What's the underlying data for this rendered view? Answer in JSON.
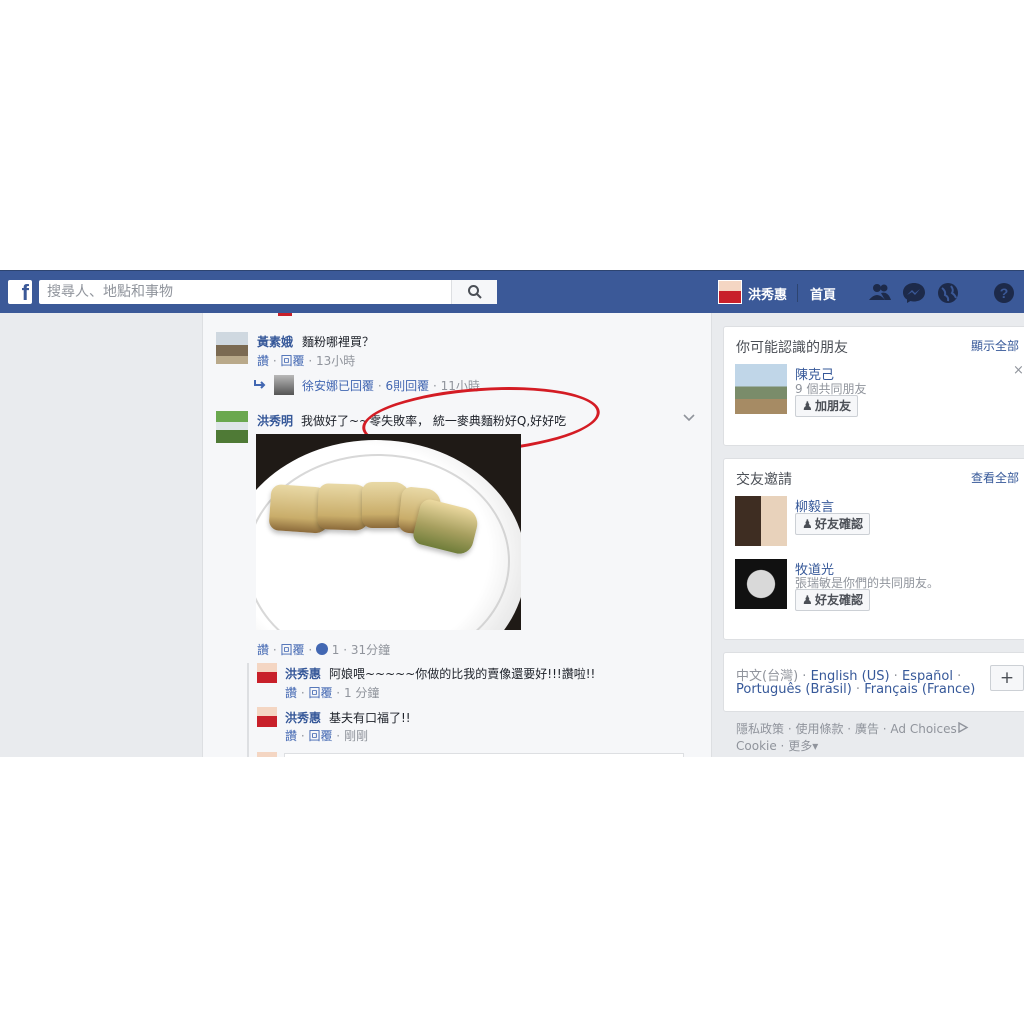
{
  "search": {
    "placeholder": "搜尋人、地點和事物"
  },
  "topbar": {
    "user_name": "洪秀惠",
    "home_label": "首頁"
  },
  "comments": [
    {
      "author": "黃素娥",
      "text": "麵粉哪裡買？",
      "like": "讚",
      "reply": "回覆",
      "time": "13小時",
      "replies_summary": {
        "author": "徐安娜",
        "action": "已回覆",
        "count": "6則回覆",
        "time": "11小時"
      }
    },
    {
      "author": "洪秀明",
      "text": "我做好了~~零失敗率， 統一麥典麵粉好Q,好好吃",
      "like": "讚",
      "reply": "回覆",
      "reaction_count": "1",
      "time": "31分鐘",
      "replies": [
        {
          "author": "洪秀惠",
          "text": "阿娘喂~~~~~你做的比我的賣像還要好!!!讚啦!!",
          "like": "讚",
          "reply": "回覆",
          "time": "1 分鐘"
        },
        {
          "author": "洪秀惠",
          "text": "基夫有口福了!!",
          "like": "讚",
          "reply": "回覆",
          "time": "剛剛"
        }
      ]
    }
  ],
  "pymk": {
    "title": "你可能認識的朋友",
    "see_all": "顯示全部",
    "person": {
      "name": "陳克己",
      "mutual": "9 個共同朋友",
      "button": "加朋友"
    }
  },
  "friend_requests": {
    "title": "交友邀請",
    "see_all": "查看全部",
    "items": [
      {
        "name": "柳毅言",
        "sub": "",
        "button": "好友確認"
      },
      {
        "name": "牧道光",
        "sub": "張瑞敏是你們的共同朋友。",
        "button": "好友確認"
      }
    ]
  },
  "languages": {
    "current": "中文(台灣)",
    "options": [
      "English (US)",
      "Español",
      "Português (Brasil)",
      "Français (France)"
    ],
    "add": "+"
  },
  "footer": {
    "privacy": "隱私政策",
    "terms": "使用條款",
    "ads": "廣告",
    "ad_choices": "Ad Choices",
    "cookie": "Cookie",
    "more": "更多"
  },
  "colors": {
    "topbar": "#3b5998",
    "link": "#365899",
    "annotation": "#d41c24"
  }
}
